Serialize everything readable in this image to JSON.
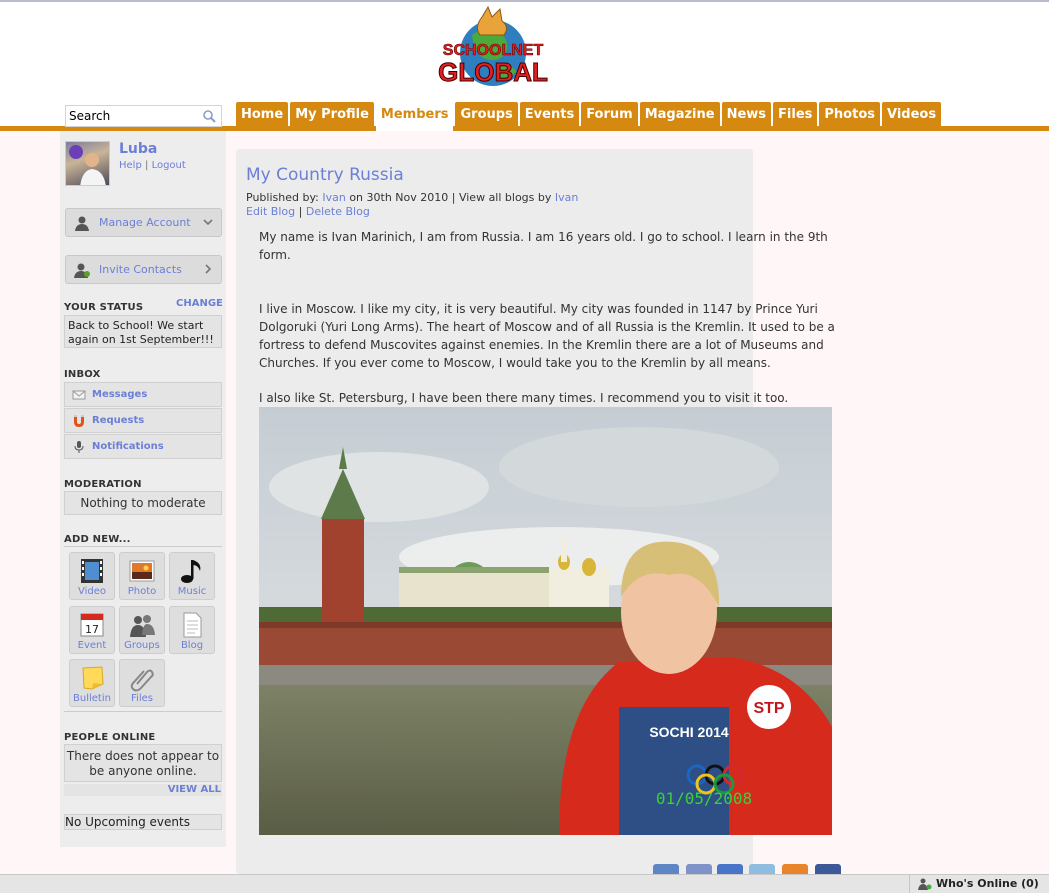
{
  "nav": {
    "tabs": [
      "Home",
      "My Profile",
      "Members",
      "Groups",
      "Events",
      "Forum",
      "Magazine",
      "News",
      "Files",
      "Photos",
      "Videos"
    ],
    "active": "Members"
  },
  "search": {
    "value": "Search"
  },
  "user": {
    "name": "Luba",
    "help": "Help",
    "logout": "Logout",
    "separator": "|"
  },
  "sidebar": {
    "manage_account": "Manage Account",
    "invite_contacts": "Invite Contacts",
    "status_heading": "YOUR STATUS",
    "status_change": "CHANGE",
    "status_text": "Back to School! We start again on 1st September!!!",
    "inbox_heading": "INBOX",
    "inbox": [
      "Messages",
      "Requests",
      "Notifications"
    ],
    "moderation_heading": "MODERATION",
    "moderation_text": "Nothing to moderate",
    "addnew_heading": "ADD NEW...",
    "addnew": [
      "Video",
      "Photo",
      "Music",
      "Event",
      "Groups",
      "Blog",
      "Bulletin",
      "Files"
    ],
    "event_icon_number": "17",
    "online_heading": "PEOPLE ONLINE",
    "online_text": "There does not appear to be anyone online.",
    "view_all": "VIEW ALL",
    "events_text": "No Upcoming events"
  },
  "blog": {
    "title": "My Country Russia",
    "published_by": "Published by:",
    "author": "Ivan",
    "date_text": "on 30th Nov 2010 | View all blogs by",
    "edit": "Edit Blog",
    "delete": "Delete Blog",
    "separator": "|",
    "paragraphs": [
      "My name is Ivan Marinich, I am from Russia. I am 16 years old. I go to school. I learn in the 9th form.",
      "I live in Moscow. I like my city, it is very beautiful. My city was founded in 1147 by Prince Yuri Dolgoruki (Yuri Long Arms). The heart of Moscow and of all Russia is the Kremlin. It used to be a fortress to defend Muscovites against enemies. In the Kremlin there are a lot of Museums and Churches. If you ever come to Moscow, I would take you to the Kremlin by all means.",
      "I also like St. Petersburg, I have been there many times. I recommend you to visit it too."
    ],
    "photo_stamp": "01/05/2008",
    "photo_shirt_text": "SOCHI 2014",
    "photo_badge": "STP"
  },
  "share_icons": [
    "digg-icon",
    "myspace-icon",
    "google-icon",
    "delicious-icon",
    "stumbleupon-icon",
    "facebook-icon"
  ],
  "share_colors": [
    "#5e85c6",
    "#7f93c9",
    "#4a74c9",
    "#8fbde0",
    "#e9842b",
    "#3b5998"
  ],
  "status_bar": {
    "whos_online": "Who's Online (0)"
  },
  "colors": {
    "accent": "#d68911",
    "link": "#6b7fd6"
  }
}
